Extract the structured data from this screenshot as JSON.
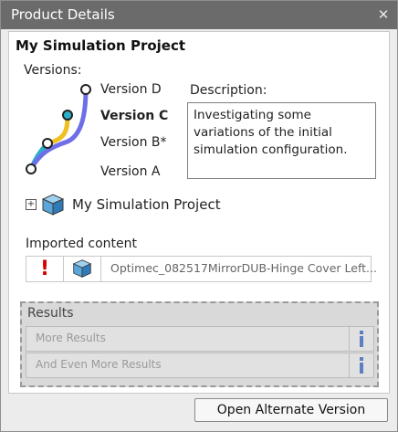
{
  "window": {
    "title": "Product Details"
  },
  "project": {
    "title": "My Simulation Project"
  },
  "versions": {
    "label": "Versions:",
    "items": [
      {
        "name": "Version D",
        "current": false
      },
      {
        "name": "Version C",
        "current": true
      },
      {
        "name": "Version B*",
        "current": false
      },
      {
        "name": "Version A",
        "current": false
      }
    ],
    "branch_colors": {
      "main": "#6e6ee8",
      "branch": "#f0c020",
      "trunk": "#2ab0c8"
    }
  },
  "description": {
    "label": "Description:",
    "text": "Investigating some variations of the initial simulation configuration."
  },
  "tree": {
    "item_label": "My Simulation Project",
    "icon": "cube-icon"
  },
  "imported": {
    "label": "Imported content",
    "items": [
      {
        "name": "Optimec_082517MirrorDUB-Hinge Cover Left...",
        "status": "error"
      }
    ]
  },
  "results": {
    "title": "Results",
    "items": [
      {
        "label": "More Results"
      },
      {
        "label": "And Even More Results"
      }
    ]
  },
  "actions": {
    "open_alternate": "Open Alternate Version"
  }
}
